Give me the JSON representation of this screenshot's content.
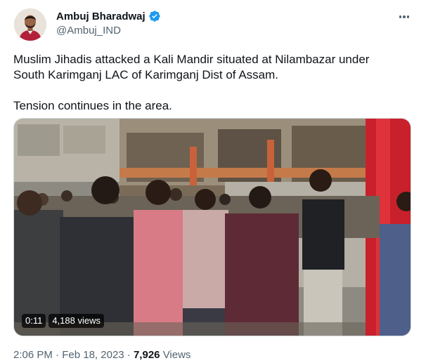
{
  "author": {
    "display_name": "Ambuj Bharadwaj",
    "handle": "@Ambuj_IND",
    "verified_icon": "verified-badge-icon"
  },
  "tweet": {
    "line1": "Muslim Jihadis attacked a Kali Mandir situated at Nilambazar under",
    "line2": "South Karimganj LAC of Karimganj Dist of Assam.",
    "line3": "Tension continues in the area."
  },
  "video": {
    "duration": "0:11",
    "views": "4,188 views"
  },
  "meta": {
    "time": "2:06 PM",
    "dot1": "·",
    "date": "Feb 18, 2023",
    "dot2": "·",
    "views_count": "7,926",
    "views_label": "Views"
  },
  "colors": {
    "text_primary": "#0f1419",
    "text_secondary": "#536471",
    "verified_blue": "#1d9bf0",
    "border": "#cfd9de"
  }
}
